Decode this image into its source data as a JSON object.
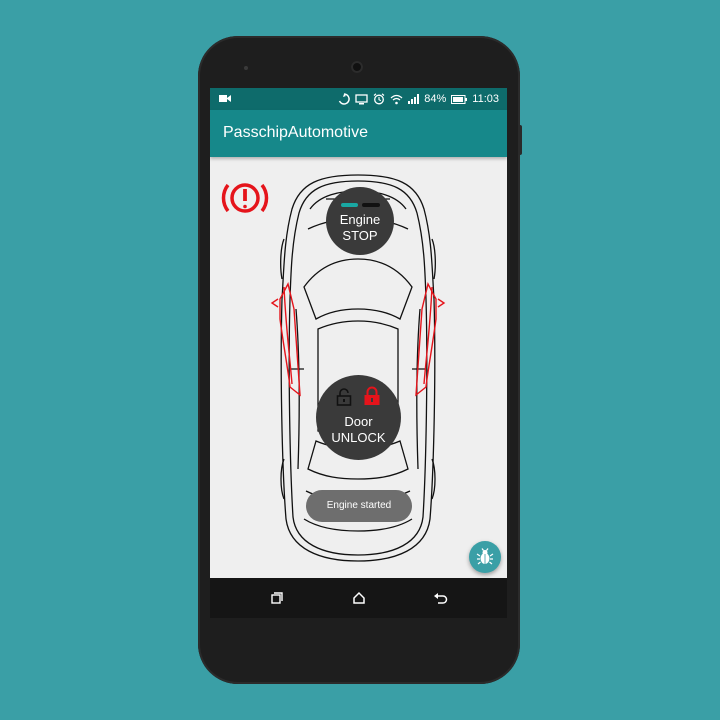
{
  "status_bar": {
    "battery": "84%",
    "time": "11:03",
    "icons": [
      "video-icon",
      "sync-icon",
      "cast-icon",
      "alarm-icon",
      "wifi-icon",
      "signal-icon",
      "battery-icon"
    ]
  },
  "app_bar": {
    "title": "PasschipAutomotive"
  },
  "warning": {
    "icon": "brake-warning-icon",
    "color": "#E5141B"
  },
  "engine": {
    "line1": "Engine",
    "line2": "STOP",
    "indicators": [
      "teal-on",
      "black-off"
    ]
  },
  "door": {
    "line1": "Door",
    "line2": "UNLOCK",
    "icons": [
      "unlocked-padlock-icon",
      "locked-padlock-icon"
    ]
  },
  "toast": {
    "text": "Engine started"
  },
  "fab": {
    "icon": "bug-icon"
  },
  "navbar": {
    "items": [
      "recent-apps-icon",
      "home-icon",
      "back-icon"
    ]
  },
  "colors": {
    "background": "#3A9FA6",
    "appbar": "#16888A",
    "statusbar": "#0E6B6B",
    "accent_red": "#E5141B",
    "disc": "#3A3A3A"
  }
}
